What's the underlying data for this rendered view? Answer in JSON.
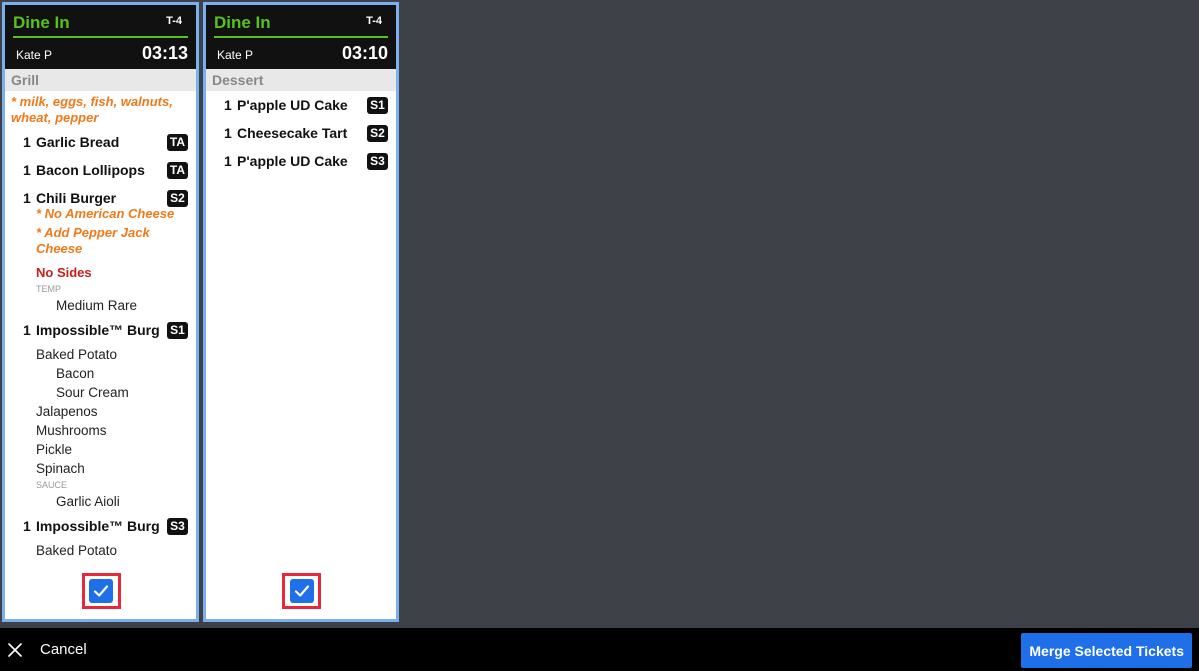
{
  "tickets": [
    {
      "order_type": "Dine In",
      "table": "T-4",
      "server": "Kate P",
      "timer": "03:13",
      "station": "Grill",
      "allergy": "* milk, eggs, fish, walnuts, wheat, pepper",
      "items": [
        {
          "qty": "1",
          "name": "Garlic Bread",
          "seat": "TA"
        },
        {
          "qty": "1",
          "name": "Bacon Lollipops",
          "seat": "TA"
        },
        {
          "qty": "1",
          "name": "Chili Burger",
          "seat": "S2",
          "mods_orange": [
            "* No American Cheese",
            "* Add Pepper Jack Cheese"
          ],
          "mod_red": "No Sides",
          "label": "TEMP",
          "sub": "Medium Rare"
        },
        {
          "qty": "1",
          "name": "Impossible™ Burg",
          "seat": "S1",
          "mods": [
            "Baked Potato",
            "Bacon",
            "Sour Cream",
            "Jalapenos",
            "Mushrooms",
            "Pickle",
            "Spinach"
          ],
          "label": "SAUCE",
          "sub": "Garlic Aioli"
        },
        {
          "qty": "1",
          "name": "Impossible™ Burg",
          "seat": "S3",
          "mods": [
            "Baked Potato"
          ]
        }
      ],
      "selected": true
    },
    {
      "order_type": "Dine In",
      "table": "T-4",
      "server": "Kate P",
      "timer": "03:10",
      "station": "Dessert",
      "items": [
        {
          "qty": "1",
          "name": "P'apple UD Cake",
          "seat": "S1"
        },
        {
          "qty": "1",
          "name": "Cheesecake Tart",
          "seat": "S2"
        },
        {
          "qty": "1",
          "name": "P'apple UD Cake",
          "seat": "S3"
        }
      ],
      "selected": true
    }
  ],
  "footer": {
    "cancel_label": "Cancel",
    "merge_label": "Merge Selected Tickets"
  },
  "colors": {
    "order_type": "#55c21d",
    "allergy": "#f07a1a",
    "no_sides": "#c81e1e",
    "accent_blue": "#1e6fe8",
    "selection_border": "#7ab0ee",
    "highlight": "#e8273a"
  },
  "icons": {
    "cancel": "close-icon",
    "checkbox": "checkmark-icon"
  }
}
